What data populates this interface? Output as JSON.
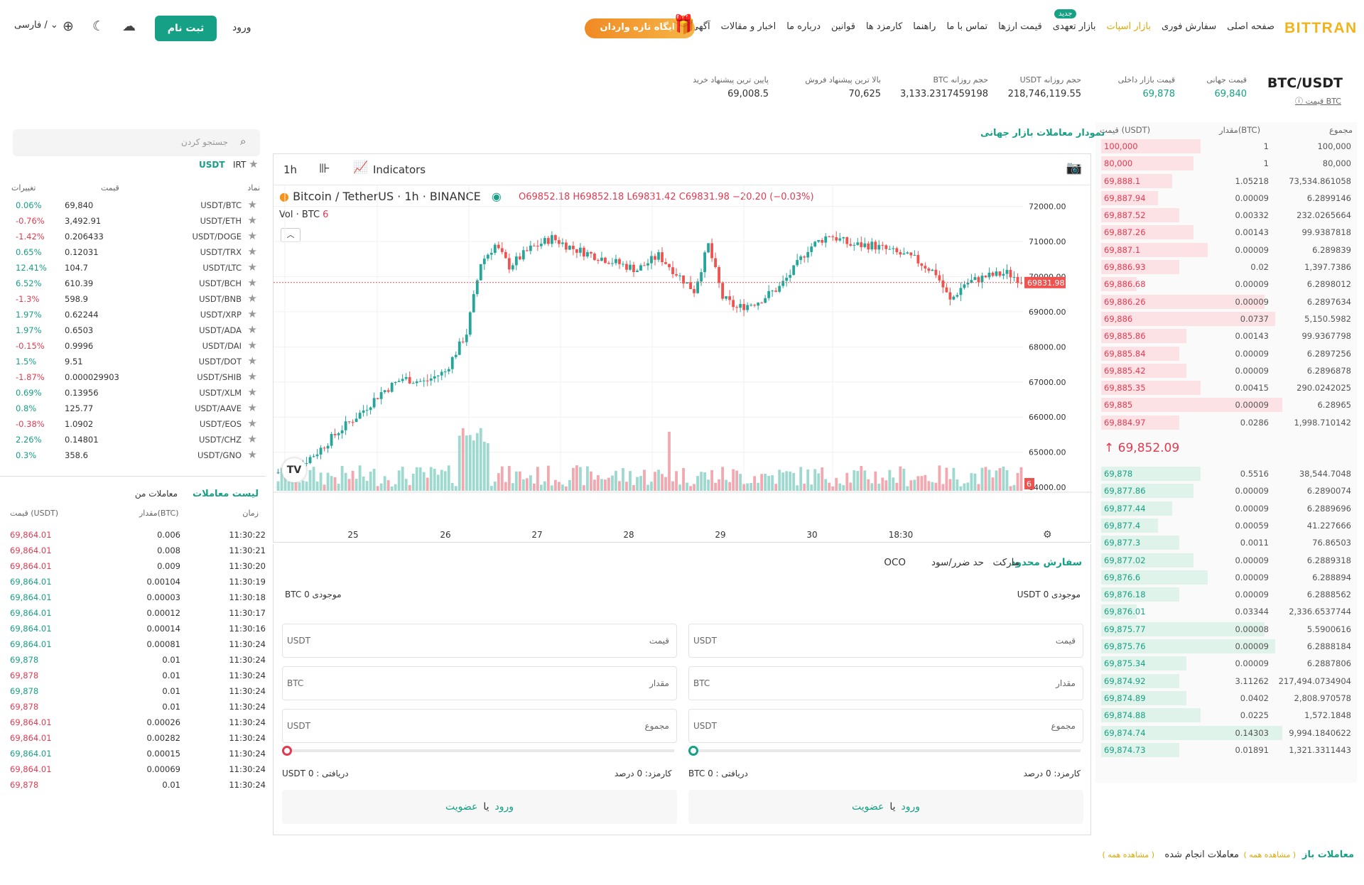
{
  "nav": {
    "logo": "BITTRAN",
    "items": [
      "صفحه اصلی",
      "سفارش فوری",
      "بازار اسپات",
      "بازار تعهدی",
      "قیمت ارزها",
      "تماس با ما",
      "راهنما",
      "کارمزد ها",
      "قوانین",
      "درباره ما",
      "اخبار و مقالات",
      "آگهی"
    ],
    "new_badge": "جدید",
    "promo": "جایگاه تازه واردان",
    "login": "ورود",
    "signup": "ثبت نام",
    "lang": "/ فارسی"
  },
  "ticker": {
    "pair": "BTC/USDT",
    "pair_sub": "قیمت BTC",
    "global_label": "قیمت جهانی",
    "global_value": "69,840",
    "local_label": "قیمت بازار داخلی",
    "local_value": "69,878",
    "vol_usdt_label": "حجم روزانه USDT",
    "vol_usdt": "218,746,119.55",
    "vol_btc_label": "حجم روزانه BTC",
    "vol_btc": "3,133.2317459198",
    "high_ask_label": "بالا ترین پیشنهاد فروش",
    "high_ask": "70,625",
    "low_bid_label": "پایین ترین پیشنهاد خرید",
    "low_bid": "69,008.5"
  },
  "orderbook": {
    "headers": [
      "مجموع",
      "مقدار(BTC)",
      "قیمت (USDT)"
    ],
    "mid_price": "69,852.09",
    "asks": [
      [
        "100,000",
        "1",
        "100,000"
      ],
      [
        "80,000",
        "1",
        "80,000"
      ],
      [
        "69,888.1",
        "1.05218",
        "73,534.861058"
      ],
      [
        "69,887.94",
        "0.00009",
        "6.2899146"
      ],
      [
        "69,887.52",
        "0.00332",
        "232.0265664"
      ],
      [
        "69,887.26",
        "0.00143",
        "99.9387818"
      ],
      [
        "69,887.1",
        "0.00009",
        "6.289839"
      ],
      [
        "69,886.93",
        "0.02",
        "1,397.7386"
      ],
      [
        "69,886.68",
        "0.00009",
        "6.2898012"
      ],
      [
        "69,886.26",
        "0.00009",
        "6.2897634"
      ],
      [
        "69,886",
        "0.0737",
        "5,150.5982"
      ],
      [
        "69,885.86",
        "0.00143",
        "99.9367798"
      ],
      [
        "69,885.84",
        "0.00009",
        "6.2897256"
      ],
      [
        "69,885.42",
        "0.00009",
        "6.2896878"
      ],
      [
        "69,885.35",
        "0.00415",
        "290.0242025"
      ],
      [
        "69,885",
        "0.00009",
        "6.28965"
      ],
      [
        "69,884.97",
        "0.0286",
        "1,998.710142"
      ]
    ],
    "bids": [
      [
        "69,878",
        "0.5516",
        "38,544.7048"
      ],
      [
        "69,877.86",
        "0.00009",
        "6.2890074"
      ],
      [
        "69,877.44",
        "0.00009",
        "6.2889696"
      ],
      [
        "69,877.4",
        "0.00059",
        "41.227666"
      ],
      [
        "69,877.3",
        "0.0011",
        "76.86503"
      ],
      [
        "69,877.02",
        "0.00009",
        "6.2889318"
      ],
      [
        "69,876.6",
        "0.00009",
        "6.288894"
      ],
      [
        "69,876.18",
        "0.00009",
        "6.2888562"
      ],
      [
        "69,876.01",
        "0.03344",
        "2,336.6537744"
      ],
      [
        "69,875.77",
        "0.00008",
        "5.5900616"
      ],
      [
        "69,875.76",
        "0.00009",
        "6.2888184"
      ],
      [
        "69,875.34",
        "0.00009",
        "6.2887806"
      ],
      [
        "69,874.92",
        "3.11262",
        "217,494.0734904"
      ],
      [
        "69,874.89",
        "0.0402",
        "2,808.970578"
      ],
      [
        "69,874.88",
        "0.0225",
        "1,572.1848"
      ],
      [
        "69,874.74",
        "0.14303",
        "9,994.1840622"
      ],
      [
        "69,874.73",
        "0.01891",
        "1,321.3311443"
      ]
    ]
  },
  "chart": {
    "title": "نمودار معاملات بازار جهانی",
    "interval": "1h",
    "indicators": "Indicators",
    "symbol": "Bitcoin / TetherUS · 1h · BINANCE",
    "o": "O69852.18",
    "h": "H69852.18",
    "l": "L69831.42",
    "c": "C69831.98",
    "chg": "−20.20 (−0.03%)",
    "vol": "Vol · BTC",
    "vol_val": "6",
    "last": "69831.98",
    "vol_tag": "6"
  },
  "chart_data": {
    "type": "candlestick",
    "title": "Bitcoin / TetherUS · 1h · BINANCE",
    "x_ticks": [
      "25",
      "26",
      "27",
      "28",
      "29",
      "30",
      "18:30"
    ],
    "y_ticks": [
      "72000.00",
      "71000.00",
      "70000.00",
      "69000.00",
      "68000.00",
      "67000.00",
      "66000.00",
      "65000.00",
      "64000.00"
    ],
    "ylim": [
      63900,
      72600
    ],
    "last_price": 69831.98,
    "price_path": [
      [
        0,
        64400
      ],
      [
        6,
        64550
      ],
      [
        12,
        65000
      ],
      [
        18,
        65600
      ],
      [
        24,
        66100
      ],
      [
        30,
        66700
      ],
      [
        36,
        67100
      ],
      [
        42,
        67000
      ],
      [
        48,
        67300
      ],
      [
        54,
        68400
      ],
      [
        58,
        70400
      ],
      [
        62,
        70900
      ],
      [
        66,
        70300
      ],
      [
        72,
        70800
      ],
      [
        78,
        71100
      ],
      [
        84,
        70800
      ],
      [
        90,
        70600
      ],
      [
        96,
        70400
      ],
      [
        102,
        70200
      ],
      [
        108,
        70600
      ],
      [
        114,
        70000
      ],
      [
        118,
        69600
      ],
      [
        122,
        70900
      ],
      [
        126,
        69400
      ],
      [
        130,
        69100
      ],
      [
        136,
        69300
      ],
      [
        142,
        69700
      ],
      [
        146,
        70200
      ],
      [
        150,
        70800
      ],
      [
        156,
        71200
      ],
      [
        162,
        70900
      ],
      [
        168,
        70900
      ],
      [
        174,
        70700
      ],
      [
        180,
        70500
      ],
      [
        186,
        70100
      ],
      [
        190,
        69300
      ],
      [
        194,
        69800
      ],
      [
        200,
        70000
      ],
      [
        206,
        70100
      ],
      [
        210,
        69900
      ]
    ]
  },
  "orderform": {
    "tabs": [
      "سفارش محدود",
      "مارکت",
      "حد ضرر/سود",
      "OCO"
    ],
    "buy_balance": "موجودی 0 USDT",
    "sell_balance": "موجودی 0 BTC",
    "price": "قیمت",
    "amount": "مقدار",
    "total": "مجموع",
    "usdt": "USDT",
    "btc": "BTC",
    "fee": "کارمزد: 0 درصد",
    "buy_receive": "دریافتی : 0 BTC",
    "sell_receive": "دریافتی : 0 USDT",
    "login": "ورود",
    "or": "یا",
    "register": "عضویت"
  },
  "markets": {
    "search": "جستجو کردن",
    "tabs": [
      "USDT",
      "IRT"
    ],
    "headers": [
      "نماد",
      "قیمت",
      "تغییرات"
    ],
    "rows": [
      [
        "USDT/BTC",
        "69,840",
        "0.06%",
        "up"
      ],
      [
        "USDT/ETH",
        "3,492.91",
        "-0.76%",
        "down"
      ],
      [
        "USDT/DOGE",
        "0.206433",
        "-1.42%",
        "down"
      ],
      [
        "USDT/TRX",
        "0.12031",
        "0.65%",
        "up"
      ],
      [
        "USDT/LTC",
        "104.7",
        "12.41%",
        "up"
      ],
      [
        "USDT/BCH",
        "610.39",
        "6.52%",
        "up"
      ],
      [
        "USDT/BNB",
        "598.9",
        "-1.3%",
        "down"
      ],
      [
        "USDT/XRP",
        "0.62244",
        "1.97%",
        "up"
      ],
      [
        "USDT/ADA",
        "0.6503",
        "1.97%",
        "up"
      ],
      [
        "USDT/DAI",
        "0.9996",
        "-0.15%",
        "down"
      ],
      [
        "USDT/DOT",
        "9.51",
        "1.5%",
        "up"
      ],
      [
        "USDT/SHIB",
        "0.000029903",
        "-1.87%",
        "down"
      ],
      [
        "USDT/XLM",
        "0.13956",
        "0.69%",
        "up"
      ],
      [
        "USDT/AAVE",
        "125.77",
        "0.8%",
        "up"
      ],
      [
        "USDT/EOS",
        "1.0902",
        "-0.38%",
        "down"
      ],
      [
        "USDT/CHZ",
        "0.14801",
        "2.26%",
        "up"
      ],
      [
        "USDT/GNO",
        "358.6",
        "0.3%",
        "up"
      ]
    ]
  },
  "trades": {
    "tabs": [
      "لیست معاملات",
      "معاملات من"
    ],
    "headers": [
      "زمان",
      "مقدار(BTC)",
      "قیمت (USDT)"
    ],
    "rows": [
      [
        "11:30:22",
        "0.006",
        "69,864.01",
        "down"
      ],
      [
        "11:30:21",
        "0.008",
        "69,864.01",
        "down"
      ],
      [
        "11:30:20",
        "0.009",
        "69,864.01",
        "down"
      ],
      [
        "11:30:19",
        "0.00104",
        "69,864.01",
        "up"
      ],
      [
        "11:30:18",
        "0.00003",
        "69,864.01",
        "up"
      ],
      [
        "11:30:17",
        "0.00012",
        "69,864.01",
        "up"
      ],
      [
        "11:30:16",
        "0.00014",
        "69,864.01",
        "up"
      ],
      [
        "11:30:24",
        "0.00081",
        "69,864.01",
        "up"
      ],
      [
        "11:30:24",
        "0.01",
        "69,878",
        "up"
      ],
      [
        "11:30:24",
        "0.01",
        "69,878",
        "down"
      ],
      [
        "11:30:24",
        "0.01",
        "69,878",
        "up"
      ],
      [
        "11:30:24",
        "0.01",
        "69,878",
        "down"
      ],
      [
        "11:30:24",
        "0.00026",
        "69,864.01",
        "down"
      ],
      [
        "11:30:24",
        "0.00282",
        "69,864.01",
        "down"
      ],
      [
        "11:30:24",
        "0.00015",
        "69,864.01",
        "up"
      ],
      [
        "11:30:24",
        "0.00069",
        "69,864.01",
        "down"
      ],
      [
        "11:30:24",
        "0.01",
        "69,878",
        "down"
      ]
    ]
  },
  "bottom": {
    "open": "معاملات باز",
    "open_all": "( مشاهده همه )",
    "done": "معاملات انجام شده",
    "done_all": "( مشاهده همه )"
  }
}
